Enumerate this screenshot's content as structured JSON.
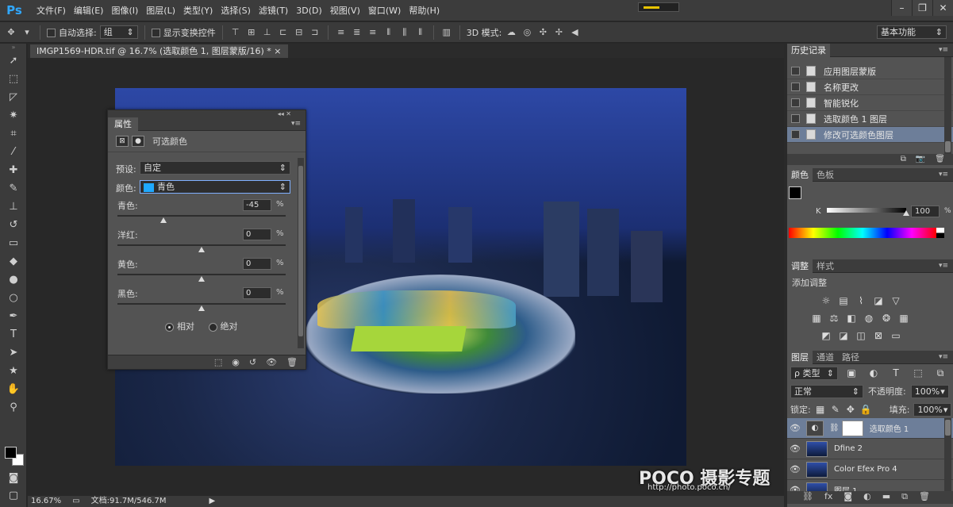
{
  "app": {
    "logo": "Ps"
  },
  "menubar": {
    "items": [
      "文件(F)",
      "编辑(E)",
      "图像(I)",
      "图层(L)",
      "类型(Y)",
      "选择(S)",
      "滤镜(T)",
      "3D(D)",
      "视图(V)",
      "窗口(W)",
      "帮助(H)"
    ]
  },
  "window_controls": {
    "minimize": "–",
    "restore": "❐",
    "close": "✕"
  },
  "options": {
    "auto_select_label": "自动选择:",
    "auto_select_value": "组",
    "show_transform_label": "显示变换控件",
    "mode_3d_label": "3D 模式:",
    "workspace": "基本功能"
  },
  "document": {
    "tab": "IMGP1569-HDR.tif @ 16.7% (选取颜色 1, 图层蒙版/16) *"
  },
  "properties": {
    "tab": "属性",
    "title": "可选颜色",
    "preset_label": "预设:",
    "preset_value": "自定",
    "color_label": "颜色:",
    "color_value": "青色",
    "color_swatch": "#1fa9ff",
    "sliders": [
      {
        "label": "青色:",
        "value": "-45",
        "unit": "%",
        "percent": -45
      },
      {
        "label": "洋红:",
        "value": "0",
        "unit": "%",
        "percent": 0
      },
      {
        "label": "黄色:",
        "value": "0",
        "unit": "%",
        "percent": 0
      },
      {
        "label": "黑色:",
        "value": "0",
        "unit": "%",
        "percent": 0
      }
    ],
    "relative": "相对",
    "absolute": "绝对"
  },
  "status": {
    "zoom": "16.67%",
    "doc": "文档:91.7M/546.7M"
  },
  "watermark": {
    "brand": "POCO 摄影专题",
    "url": "http://photo.poco.cn/"
  },
  "history": {
    "tab": "历史记录",
    "items": [
      "应用图层蒙版",
      "名称更改",
      "智能锐化",
      "选取颜色 1 图层",
      "修改可选颜色图层"
    ],
    "selected_index": 4
  },
  "color_panel": {
    "tabs": [
      "颜色",
      "色板"
    ],
    "channel": "K",
    "value": "100",
    "value_percent": 100
  },
  "adjustments": {
    "tabs": [
      "调整",
      "样式"
    ],
    "heading": "添加调整"
  },
  "layers": {
    "tabs": [
      "图层",
      "通道",
      "路径"
    ],
    "filter": "ρ 类型",
    "blend": "正常",
    "opacity_label": "不透明度:",
    "opacity": "100%",
    "lock_label": "锁定:",
    "fill_label": "填充:",
    "fill": "100%",
    "rows": [
      {
        "name": "选取颜色 1",
        "selected": true
      },
      {
        "name": "Dfine 2",
        "selected": false
      },
      {
        "name": "Color Efex Pro 4",
        "selected": false
      },
      {
        "name": "图层 1",
        "selected": false
      }
    ]
  }
}
